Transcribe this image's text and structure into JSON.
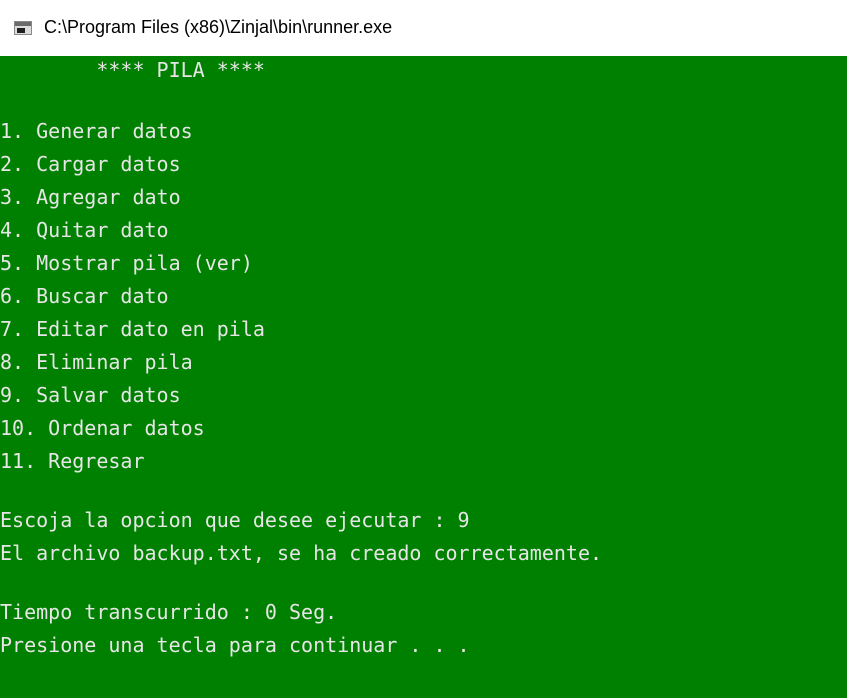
{
  "window": {
    "title": "C:\\Program Files (x86)\\Zinjal\\bin\\runner.exe",
    "icon": "console-window-icon"
  },
  "console": {
    "background": "#008000",
    "foreground": "#e6e6e6",
    "header": "        **** PILA ****",
    "menu": [
      "1. Generar datos",
      "2. Cargar datos",
      "3. Agregar dato",
      "4. Quitar dato",
      "5. Mostrar pila (ver)",
      "6. Buscar dato",
      "7. Editar dato en pila",
      "8. Eliminar pila",
      "9. Salvar datos",
      "10. Ordenar datos",
      "11. Regresar"
    ],
    "prompt": "Escoja la opcion que desee ejecutar : 9",
    "result": "El archivo backup.txt, se ha creado correctamente.",
    "elapsed": "Tiempo transcurrido : 0 Seg.",
    "continue": "Presione una tecla para continuar . . ."
  }
}
